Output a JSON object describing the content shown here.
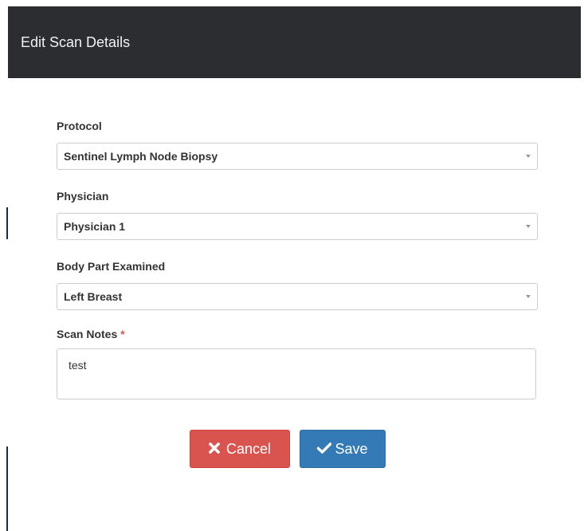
{
  "modal": {
    "title": "Edit Scan Details"
  },
  "form": {
    "protocol": {
      "label": "Protocol",
      "value": "Sentinel Lymph Node Biopsy"
    },
    "physician": {
      "label": "Physician",
      "value": "Physician 1"
    },
    "body_part": {
      "label": "Body Part Examined",
      "value": "Left Breast"
    },
    "scan_notes": {
      "label": "Scan Notes",
      "required_marker": "*",
      "value": "test"
    }
  },
  "buttons": {
    "cancel_label": "Cancel",
    "save_label": "Save",
    "cancel_icon": "times-icon",
    "save_icon": "check-icon"
  },
  "colors": {
    "header_bg": "#2b2d31",
    "cancel_bg": "#d9534f",
    "save_bg": "#337ab7",
    "required": "#d9534f"
  }
}
